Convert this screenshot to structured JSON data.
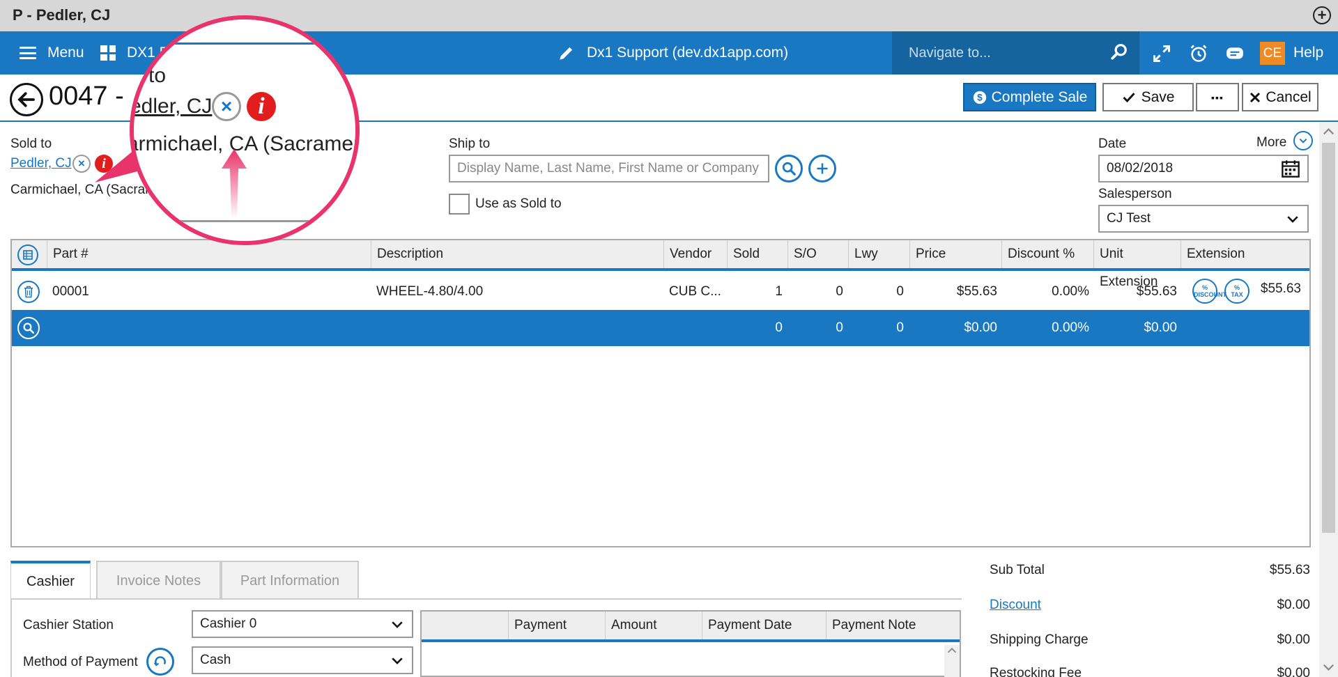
{
  "window": {
    "title": "P - Pedler, CJ"
  },
  "nav": {
    "menu_label": "Menu",
    "apps_label": "DX1 P",
    "site_label": "Dx1 Support (dev.dx1app.com)",
    "search_placeholder": "Navigate to...",
    "user_initials": "CE",
    "help_label": "Help"
  },
  "header": {
    "order_title": "0047 -",
    "complete_sale_label": "Complete Sale",
    "save_label": "Save",
    "more_dots": "▪▪▪",
    "cancel_label": "Cancel"
  },
  "sold_to": {
    "label": "Sold to",
    "customer_name": "Pedler, CJ",
    "address": "Carmichael, CA (Sacram"
  },
  "ship_to": {
    "label": "Ship to",
    "placeholder": "Display Name, Last Name, First Name or Company",
    "use_as_sold_to_label": "Use as Sold to"
  },
  "date": {
    "label": "Date",
    "more_label": "More",
    "value": "08/02/2018"
  },
  "salesperson": {
    "label": "Salesperson",
    "value": "CJ Test"
  },
  "grid": {
    "columns": [
      "Part #",
      "Description",
      "Vendor",
      "Sold",
      "S/O",
      "Lwy",
      "Price",
      "Discount %",
      "Unit Extension",
      "Extension"
    ],
    "rows": [
      {
        "part": "00001",
        "description": "WHEEL-4.80/4.00",
        "vendor": "CUB C...",
        "sold": "1",
        "so": "0",
        "lwy": "0",
        "price": "$55.63",
        "discount": "0.00%",
        "unit_ext": "$55.63",
        "extension": "$55.63",
        "discount_badge": "%\nDISCOUNT",
        "tax_badge": "%\nTAX"
      }
    ],
    "new_row": {
      "sold": "0",
      "so": "0",
      "lwy": "0",
      "price": "$0.00",
      "discount": "0.00%",
      "unit_ext": "$0.00"
    }
  },
  "tabs": [
    "Cashier",
    "Invoice Notes",
    "Part Information"
  ],
  "cashier": {
    "station_label": "Cashier Station",
    "station_value": "Cashier 0",
    "method_label": "Method of Payment",
    "method_value": "Cash"
  },
  "payments": {
    "columns": [
      "",
      "Payment",
      "Amount",
      "Payment Date",
      "Payment Note"
    ]
  },
  "totals": {
    "subtotal_label": "Sub Total",
    "subtotal_value": "$55.63",
    "discount_label": "Discount",
    "discount_value": "$0.00",
    "shipping_label": "Shipping Charge",
    "shipping_value": "$0.00",
    "restocking_label": "Restocking Fee",
    "restocking_value": "$0.00"
  },
  "magnifier": {
    "label_fragment": "d to",
    "name_fragment": "edler, CJ",
    "address_fragment": "armichael, CA (Sacrament"
  },
  "colors": {
    "accent": "#1a78c2",
    "nav": "#1a78c2",
    "callout": "#e8336b",
    "badge": "#f08a24",
    "info": "#e21d1d"
  }
}
